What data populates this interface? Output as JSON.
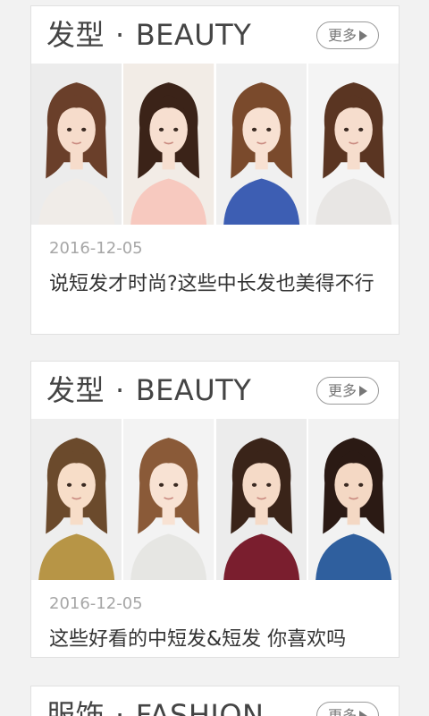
{
  "cards": [
    {
      "title_cn": "发型",
      "title_sep": "·",
      "title_en": "BEAUTY",
      "more_label": "更多",
      "date": "2016-12-05",
      "headline": "说短发才时尚?这些中长发也美得不行",
      "photos": [
        {
          "hair": "#6a3f2a",
          "top": "#f0ece8",
          "bg": "#ececec",
          "skin": "#f6dccb"
        },
        {
          "hair": "#3b2318",
          "top": "#f7c9bf",
          "bg": "#f2ece6",
          "skin": "#f7dfd0"
        },
        {
          "hair": "#7a4a2c",
          "top": "#3d5eb3",
          "bg": "#f0f0f0",
          "skin": "#f8e1d2"
        },
        {
          "hair": "#5a3522",
          "top": "#e8e6e4",
          "bg": "#f4f4f4",
          "skin": "#f6ddcd"
        }
      ]
    },
    {
      "title_cn": "发型",
      "title_sep": "·",
      "title_en": "BEAUTY",
      "more_label": "更多",
      "date": "2016-12-05",
      "headline": "这些好看的中短发&短发 你喜欢吗",
      "photos": [
        {
          "hair": "#6b4a2c",
          "top": "#b79546",
          "bg": "#eeeeee",
          "skin": "#f7ddc8"
        },
        {
          "hair": "#8a5a38",
          "top": "#e6e6e3",
          "bg": "#f3f3f3",
          "skin": "#f8e2d3"
        },
        {
          "hair": "#3a2419",
          "top": "#7a1e2e",
          "bg": "#ececec",
          "skin": "#f5dac7"
        },
        {
          "hair": "#2b1a14",
          "top": "#2f5f9e",
          "bg": "#f2f2f2",
          "skin": "#f4d8c4"
        }
      ]
    },
    {
      "title_cn": "服饰",
      "title_sep": "·",
      "title_en": "FASHION",
      "more_label": "更多"
    }
  ]
}
